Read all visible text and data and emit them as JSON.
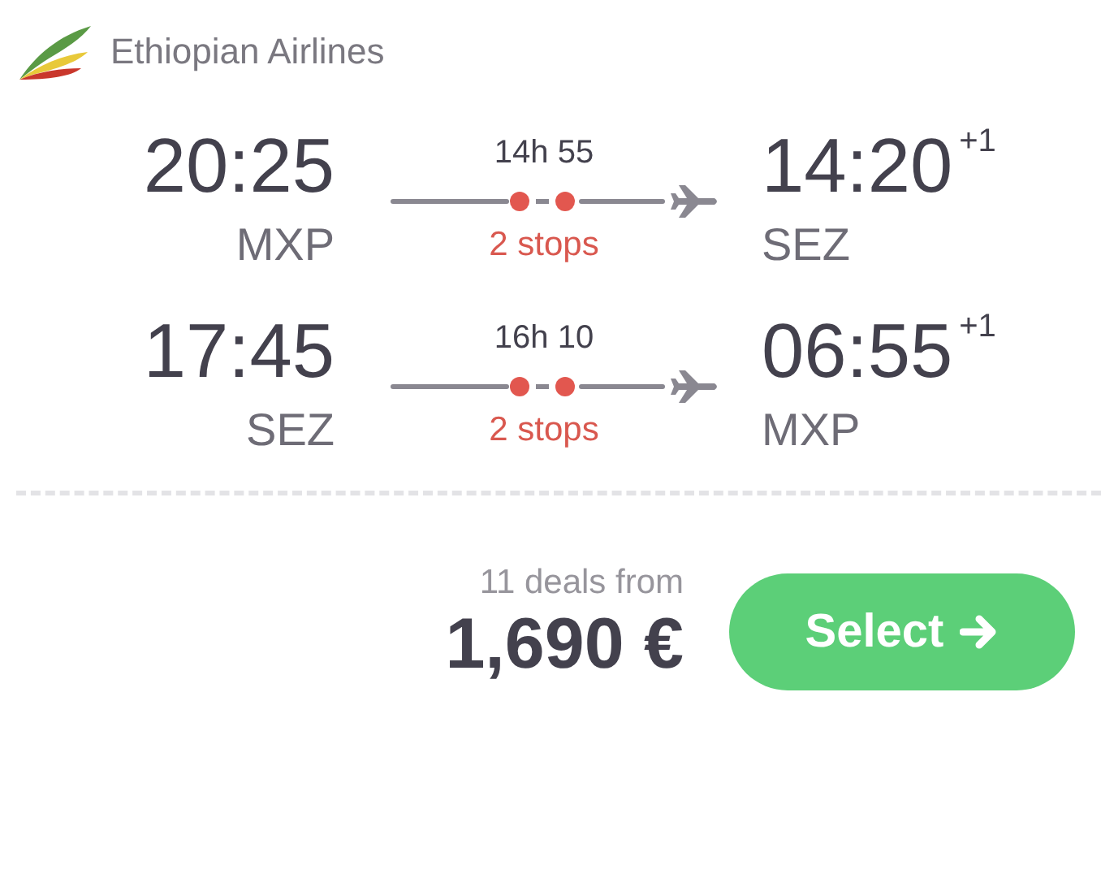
{
  "airline": {
    "name": "Ethiopian Airlines"
  },
  "legs": [
    {
      "departure_time": "20:25",
      "departure_airport": "MXP",
      "duration": "14h 55",
      "stops": "2 stops",
      "arrival_time": "14:20",
      "day_offset": "+1",
      "arrival_airport": "SEZ"
    },
    {
      "departure_time": "17:45",
      "departure_airport": "SEZ",
      "duration": "16h 10",
      "stops": "2 stops",
      "arrival_time": "06:55",
      "day_offset": "+1",
      "arrival_airport": "MXP"
    }
  ],
  "price": {
    "deals": "11 deals from",
    "amount": "1,690 €"
  },
  "select_button": {
    "label": "Select"
  }
}
